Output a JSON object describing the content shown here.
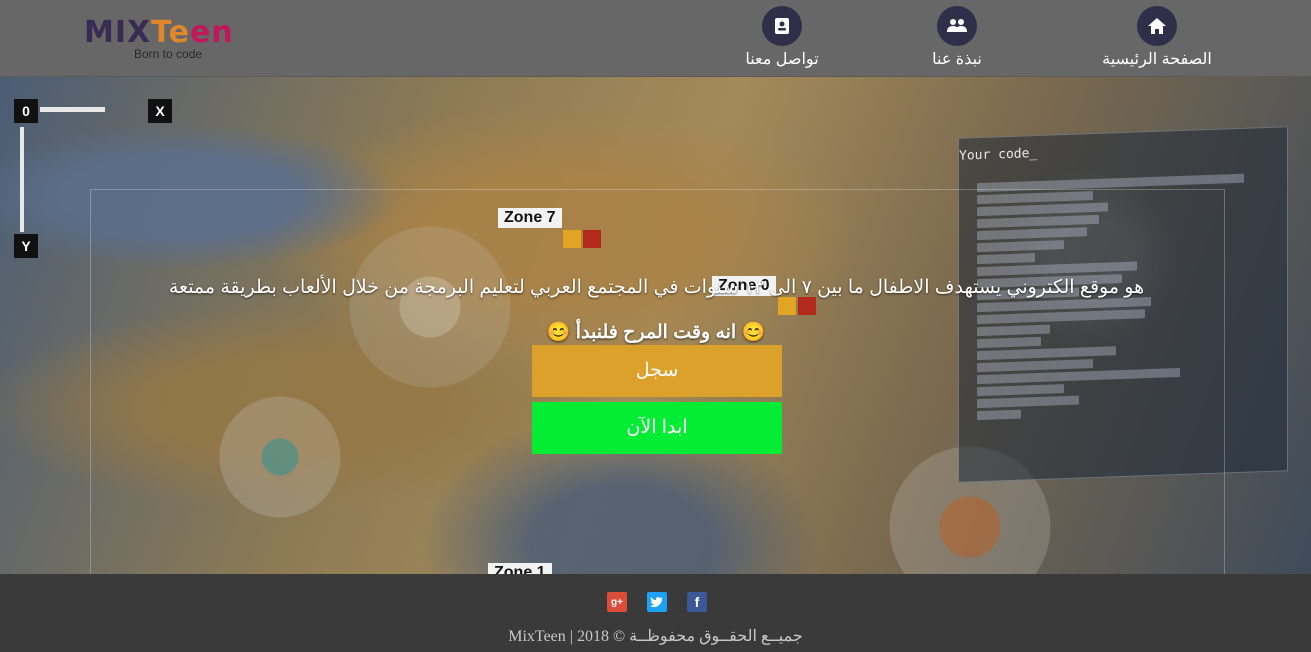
{
  "header": {
    "logo": {
      "word_part1": "MIX",
      "word_part2": "Te",
      "word_part3": "en",
      "tagline": "Born to code"
    },
    "nav": [
      {
        "label": "الصفحة الرئيسية",
        "icon": "home-icon"
      },
      {
        "label": "نبذة عنا",
        "icon": "people-icon"
      },
      {
        "label": "تواصل معنا",
        "icon": "contact-icon"
      }
    ]
  },
  "hero": {
    "background": {
      "zones": [
        "Zone 7",
        "Zone 0",
        "Zone 1"
      ],
      "hud": {
        "top_value": "0",
        "close": "X",
        "axis_y": "Y"
      },
      "code_title": "Your code_"
    },
    "description": "هو موقع الكتروني يستهدف الاطفال ما بين ٧ الى ١٣ سنوات في المجتمع العربي لتعليم البرمجة من خلال الألعاب بطريقة ممتعة",
    "slogan": "😊 انه وقت المرح فلنبدأ 😊",
    "register_button": "سجل",
    "start_button": "ابدا الآن"
  },
  "footer": {
    "social": [
      {
        "name": "google-plus",
        "glyph": "g+"
      },
      {
        "name": "twitter",
        "glyph": "t"
      },
      {
        "name": "facebook",
        "glyph": "f"
      }
    ],
    "copyright": "جميــع الحقــوق محفوظــة © 2018 | MixTeen"
  },
  "colors": {
    "header_bg": "#676767",
    "nav_icon_bg": "#2f2f4a",
    "register_button": "#dba12b",
    "start_button": "#05ec35",
    "footer_bg": "#3a3a3a"
  }
}
